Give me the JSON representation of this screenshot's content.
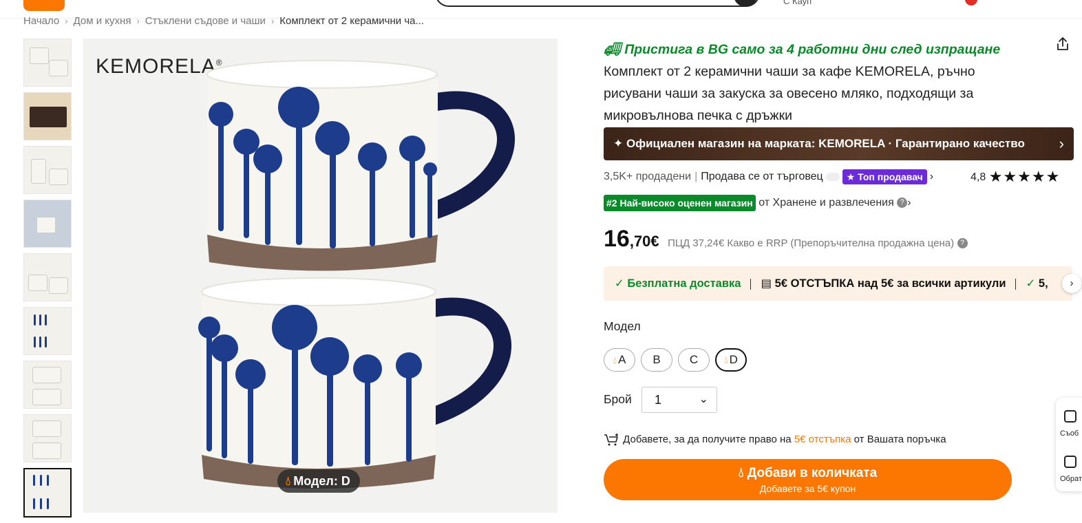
{
  "breadcrumb": {
    "items": [
      "Начало",
      "Дом и кухня",
      "Стъклени съдове и чаши"
    ],
    "current": "Комплект от 2 керамични ча...",
    "separator": "›"
  },
  "topbar": {
    "delivery_stub": "С Кауп"
  },
  "gallery": {
    "brand": "KEMORELA",
    "brand_mark": "®",
    "badge_label": "Модел: D"
  },
  "product": {
    "promo": "Пристига в BG само за 4 работни дни след изпращане",
    "title": "Комплект от 2 керамични чаши за кафе KEMORELA, ръчно рисувани чаши за закуска за овесено мляко, подходящи за микровълнова печка с дръжки",
    "official_store": "Официален магазин на марката: KEMORELA · Гарантирано качество",
    "sold": "3,5K+ продадени",
    "sold_by": "Продава се от търговец",
    "top_seller": "Топ продавач",
    "rating": "4,8",
    "stars": "★★★★★",
    "rank_badge": "#2 Най-високо оценен магазин",
    "rank_suffix": "от Хранене и развлечения",
    "price_main": "16",
    "price_cents": ",70€",
    "rrp": "ПЦД 37,24€ Какво е RRP (Препоръчителна продажна цена)",
    "benefits": {
      "free_delivery": "Безплатна доставка",
      "discount": "5€ ОТСТЪПКА над 5€ за всички артикули",
      "more": "5,"
    },
    "model_label": "Модел",
    "variants": [
      "A",
      "B",
      "C",
      "D"
    ],
    "selected_variant": "D",
    "qty_label": "Брой",
    "qty_value": "1",
    "coupon_note": {
      "before": "Добавете, за да получите право на",
      "highlight": "5€ отстъпка",
      "after": "от Вашата поръчка"
    },
    "add_to_cart": "Добави в количката",
    "add_to_cart_sub": "Добавете за 5€ купон"
  },
  "floating": {
    "item1": "Съоб",
    "item2": "Обрат"
  },
  "colors": {
    "accent": "#fb7701",
    "green": "#0a8a2a",
    "official_bar": "#4a2e20",
    "top_seller": "#6c2bd9",
    "benefits_bg": "#fdf1e5",
    "mug_blue": "#1e3c8c"
  },
  "icons": [
    "truck-icon",
    "share-icon",
    "verified-icon",
    "chevron-right-icon",
    "star-icon",
    "question-icon",
    "check-icon",
    "ticket-icon",
    "drop-icon",
    "chevron-down-icon",
    "cart-plus-icon"
  ]
}
